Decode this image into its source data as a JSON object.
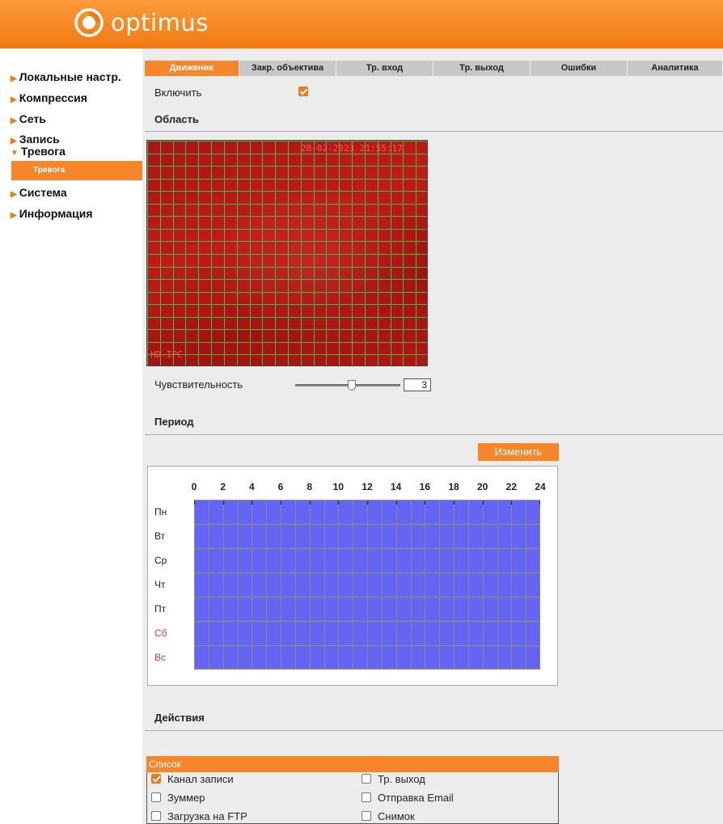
{
  "brand": {
    "name": "optimus",
    "color": "#f07a12"
  },
  "sidebar": {
    "items": [
      {
        "label": "Локальные настр.",
        "icon": "arrow-right-icon"
      },
      {
        "label": "Компрессия",
        "icon": "arrow-right-icon"
      },
      {
        "label": "Сеть",
        "icon": "arrow-right-icon"
      },
      {
        "label": "Запись",
        "icon": "arrow-right-icon"
      },
      {
        "label": "Тревога",
        "icon": "arrow-down-icon",
        "expanded": true
      },
      {
        "label": "Система",
        "icon": "arrow-right-icon"
      },
      {
        "label": "Информация",
        "icon": "arrow-right-icon"
      }
    ],
    "submenu": {
      "label": "Тревога",
      "active": true
    }
  },
  "tabs": [
    {
      "label": "Движение",
      "active": true
    },
    {
      "label": "Закр. объектива"
    },
    {
      "label": "Тр. вход"
    },
    {
      "label": "Тр. выход"
    },
    {
      "label": "Ошибки"
    },
    {
      "label": "Аналитика"
    }
  ],
  "enable": {
    "label": "Включить",
    "checked": true
  },
  "area": {
    "title": "Область",
    "osd_time": "28-02-2023 21:55:17",
    "osd_name": "HD-IPC"
  },
  "sensitivity": {
    "label": "Чувствительность",
    "value": "3",
    "fraction": 0.5
  },
  "period": {
    "title": "Период",
    "edit_label": "Изменить",
    "hours": [
      "0",
      "2",
      "4",
      "6",
      "8",
      "10",
      "12",
      "14",
      "16",
      "18",
      "20",
      "22",
      "24"
    ],
    "days": [
      "Пн",
      "Вт",
      "Ср",
      "Чт",
      "Пт",
      "Сб",
      "Вс"
    ],
    "weekend_color": "#e53935",
    "fill_color": "#6464f5"
  },
  "actions": {
    "title": "Действия",
    "list_title": "Список",
    "items": [
      {
        "label": "Канал записи",
        "checked": true
      },
      {
        "label": "Тр. выход",
        "checked": false
      },
      {
        "label": "Зуммер",
        "checked": false
      },
      {
        "label": "Отправка Email",
        "checked": false
      },
      {
        "label": "Загрузка на FTP",
        "checked": false
      },
      {
        "label": "Снимок",
        "checked": false
      }
    ]
  }
}
